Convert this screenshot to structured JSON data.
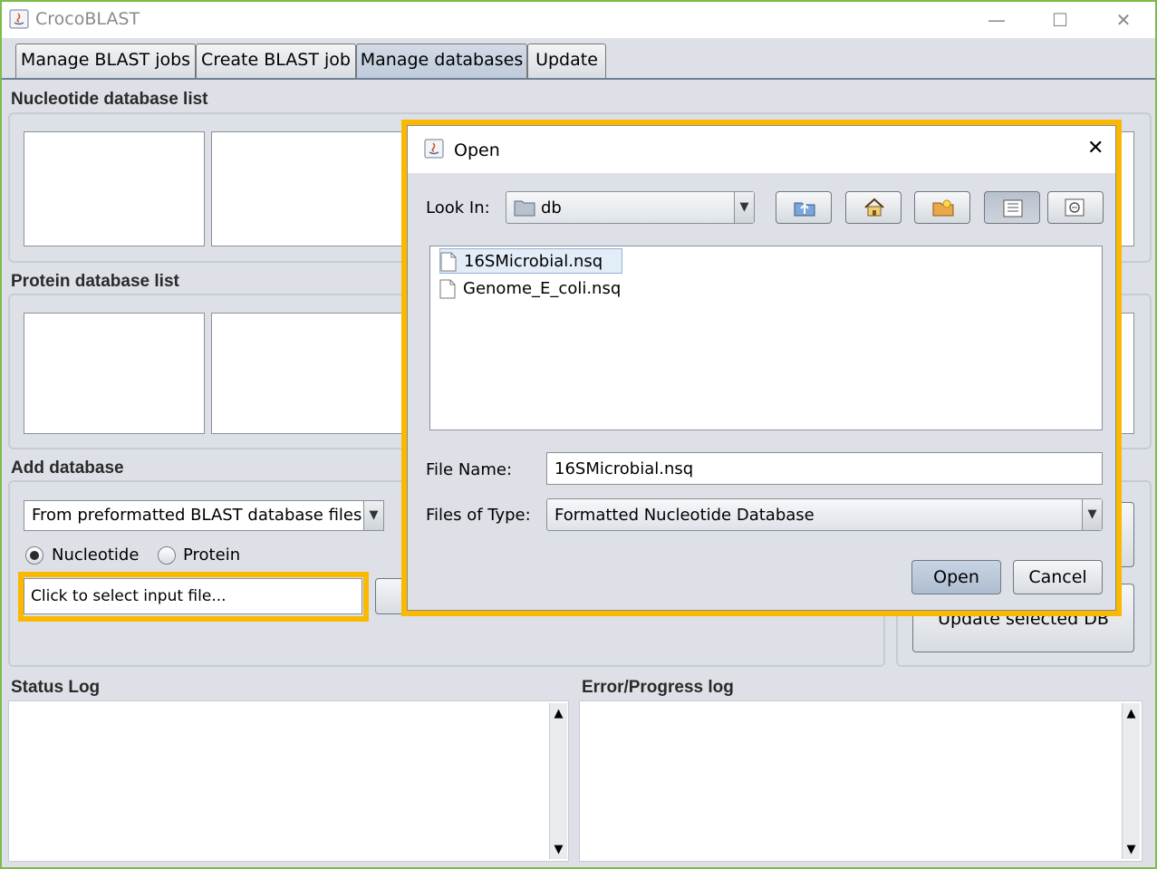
{
  "window": {
    "title": "CrocoBLAST",
    "minimize": "—",
    "maximize": "☐",
    "close": "✕",
    "border_color": "#7dbb4c"
  },
  "tabs": [
    {
      "label": "Manage BLAST jobs"
    },
    {
      "label": "Create BLAST job"
    },
    {
      "label": "Manage databases",
      "active": true
    },
    {
      "label": "Update"
    }
  ],
  "sections": {
    "nucleotide_title": "Nucleotide database list",
    "protein_title": "Protein database list",
    "add_title": "Add database",
    "status_log_title": "Status Log",
    "error_log_title": "Error/Progress log"
  },
  "add_database": {
    "source_selected": "From preformatted BLAST database files",
    "radio_nucleotide": "Nucleotide",
    "radio_protein": "Protein",
    "nucleotide_checked": true,
    "input_file_placeholder": "Click to select input file...",
    "update_button": "Update selected DB"
  },
  "dialog": {
    "title": "Open",
    "close": "✕",
    "look_in_label": "Look In:",
    "look_in_value": "db",
    "files": [
      {
        "name": "16SMicrobial.nsq",
        "selected": true
      },
      {
        "name": "Genome_E_coli.nsq",
        "selected": false
      }
    ],
    "file_name_label": "File Name:",
    "file_name_value": "16SMicrobial.nsq",
    "file_type_label": "Files of Type:",
    "file_type_value": "Formatted Nucleotide Database",
    "open_button": "Open",
    "cancel_button": "Cancel",
    "toolbar_icons": [
      "up-folder-icon",
      "home-icon",
      "new-folder-icon",
      "list-view-icon",
      "details-view-icon"
    ]
  },
  "highlight_color": "#fab800"
}
